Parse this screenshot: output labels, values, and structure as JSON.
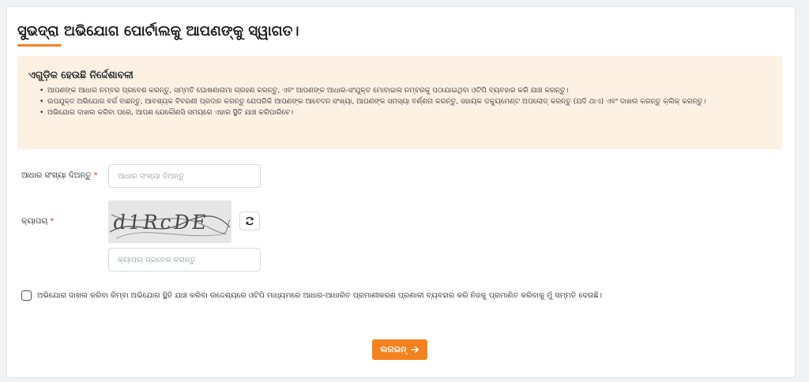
{
  "page": {
    "title": "ସୁଭଦ୍ରା ଅଭିଯୋଗ ପୋର୍ଟାଲକୁ ଆପଣଙ୍କୁ ସ୍ୱାଗତ।"
  },
  "instructions": {
    "heading": "ଏଗୁଡ଼ିକ ହେଉଛି ନିର୍ଦ୍ଦେଶାବଳୀ",
    "items": [
      "ଆପଣଙ୍କ ଆଧାର ନମ୍ବର ପ୍ରବେଶ କରନ୍ତୁ, ସମ୍ମତି ଘୋଷଣାନାମା ଗ୍ରହଣ କରନ୍ତୁ, ଏବଂ ଆପଣଙ୍କ ଆଧାର-ସଂଯୁକ୍ତ ମୋବାଇଲ ନମ୍ବରକୁ ପଠାଯାଇଥିବା ଓଟିପି ବ୍ୟବହାର କରି ଯାଞ୍ଚ କରନ୍ତୁ।",
      "ଉପଯୁକ୍ତ ଅଭିଯୋଗ ବର୍ଗ ବାଛନ୍ତୁ, ଆବଶ୍ୟକ ବିବରଣୀ ପ୍ରଦାନ କରନ୍ତୁ ଯେପରିକି ଆପଣଙ୍କ ଆବେଦନ ସଂଖ୍ୟା, ଆପଣଙ୍କ ସମସ୍ୟା ବର୍ଣ୍ଣନା କରନ୍ତୁ, ସହାୟକ ଡକ୍ୟୁମେଣ୍ଟ ଅପଲୋଡ୍ କରନ୍ତୁ (ଯଦି ଥାଏ) ଏବଂ ଦାଖଲ କରନ୍ତୁ କ୍ଲିକ୍ କରନ୍ତୁ।",
      "ଅଭିଯୋଗ ଦାଖଲ କରିବା ପରେ, ଆପଣ ଯେକୌଣସି ସମୟରେ ଏହାର ସ୍ଥିତି ଯାଞ୍ଚ କରିପାରିବେ।"
    ]
  },
  "form": {
    "aadhaar_label": "ଆଧାର ସଂଖ୍ୟା ଦିଅନ୍ତୁ",
    "aadhaar_placeholder": "ଆଧାର ସଂଖ୍ୟା ଦିଅନ୍ତୁ",
    "captcha_label": "କ୍ୟାପଚା",
    "captcha_text": "d1RcDE",
    "captcha_placeholder": "କ୍ୟାପଚା ପ୍ରବେଶ କରାନ୍ତୁ",
    "required_mark": "*",
    "refresh_icon": "refresh-icon"
  },
  "consent": {
    "text": "ଅଭିଯୋଗ ଦାଖଲ କରିବା କିମ୍ବା ଅଭିଯୋଗ ସ୍ଥିତି ଯାଞ୍ଚ କରିବା ଉଦ୍ଦେଶ୍ୟରେ ଓଟିପି ମାଧ୍ୟମରେ ଆଧାର-ଆଧାରିତ ପ୍ରମାଣୀକରଣ ପ୍ରଣାଳୀ ବ୍ୟବହାର କରି ନିଜକୁ ପ୍ରମାଣିତ କରିବାକୁ ମୁଁ ସମ୍ମତି ଦେଉଛି।",
    "checked": false
  },
  "actions": {
    "login_label": "ଲଗଇନ୍",
    "login_icon": "arrow-right-icon"
  },
  "colors": {
    "accent": "#f58220",
    "instructions_bg": "#fdf1e4",
    "required": "#d93025"
  }
}
